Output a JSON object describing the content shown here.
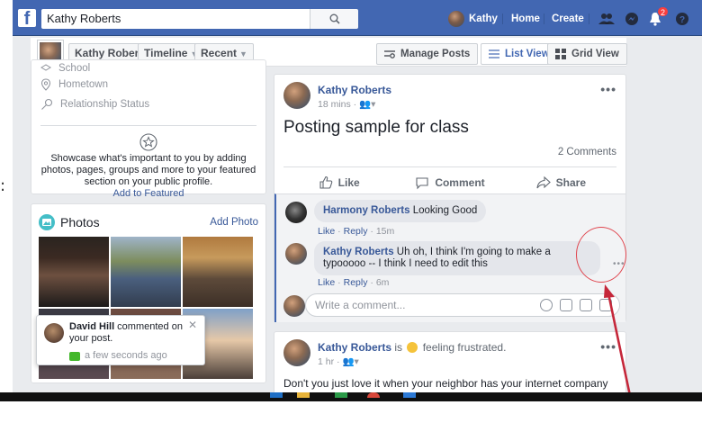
{
  "topbar": {
    "search_value": "Kathy Roberts",
    "user_name": "Kathy",
    "home_label": "Home",
    "create_label": "Create",
    "notification_count": "2",
    "icons": [
      "friends-icon",
      "messenger-icon",
      "notifications-icon",
      "help-icon"
    ]
  },
  "subbar": {
    "profile_name": "Kathy Roberts",
    "timeline_label": "Timeline",
    "recent_label": "Recent",
    "manage_posts_label": "Manage Posts",
    "list_view_label": "List View",
    "grid_view_label": "Grid View"
  },
  "intro": {
    "items": [
      {
        "label": "School",
        "icon": "school-icon"
      },
      {
        "label": "Hometown",
        "icon": "location-icon"
      },
      {
        "label": "Relationship Status",
        "icon": "relationship-icon"
      }
    ],
    "featured_text": "Showcase what's important to you by adding photos, pages, groups and more to your featured section on your public profile.",
    "featured_link": "Add to Featured"
  },
  "photos": {
    "title": "Photos",
    "add_label": "Add Photo"
  },
  "notification": {
    "actor": "David Hill",
    "text": " commented on your post.",
    "time": "a few seconds ago"
  },
  "post1": {
    "author": "Kathy Roberts",
    "meta": "18 mins · ",
    "text": "Posting sample for class",
    "comment_count": "2 Comments",
    "like_label": "Like",
    "comment_label": "Comment",
    "share_label": "Share",
    "comments": [
      {
        "author": "Harmony Roberts",
        "text": " Looking Good",
        "like": "Like",
        "reply": "Reply",
        "time": "15m"
      },
      {
        "author": "Kathy Roberts",
        "text": " Uh oh, I think I'm going to make a typooooo -- I think I need to edit this",
        "like": "Like",
        "reply": "Reply",
        "time": "6m"
      }
    ],
    "write_placeholder": "Write a comment..."
  },
  "post2": {
    "author": "Kathy Roberts",
    "feeling_prefix": " is ",
    "feeling": " feeling frustrated.",
    "meta": "1 hr · ",
    "text": "Don't you just love it when your neighbor has your internet company come out"
  },
  "colors": {
    "fb_blue": "#4267b2",
    "link": "#385898",
    "annotation": "#e0464f"
  }
}
